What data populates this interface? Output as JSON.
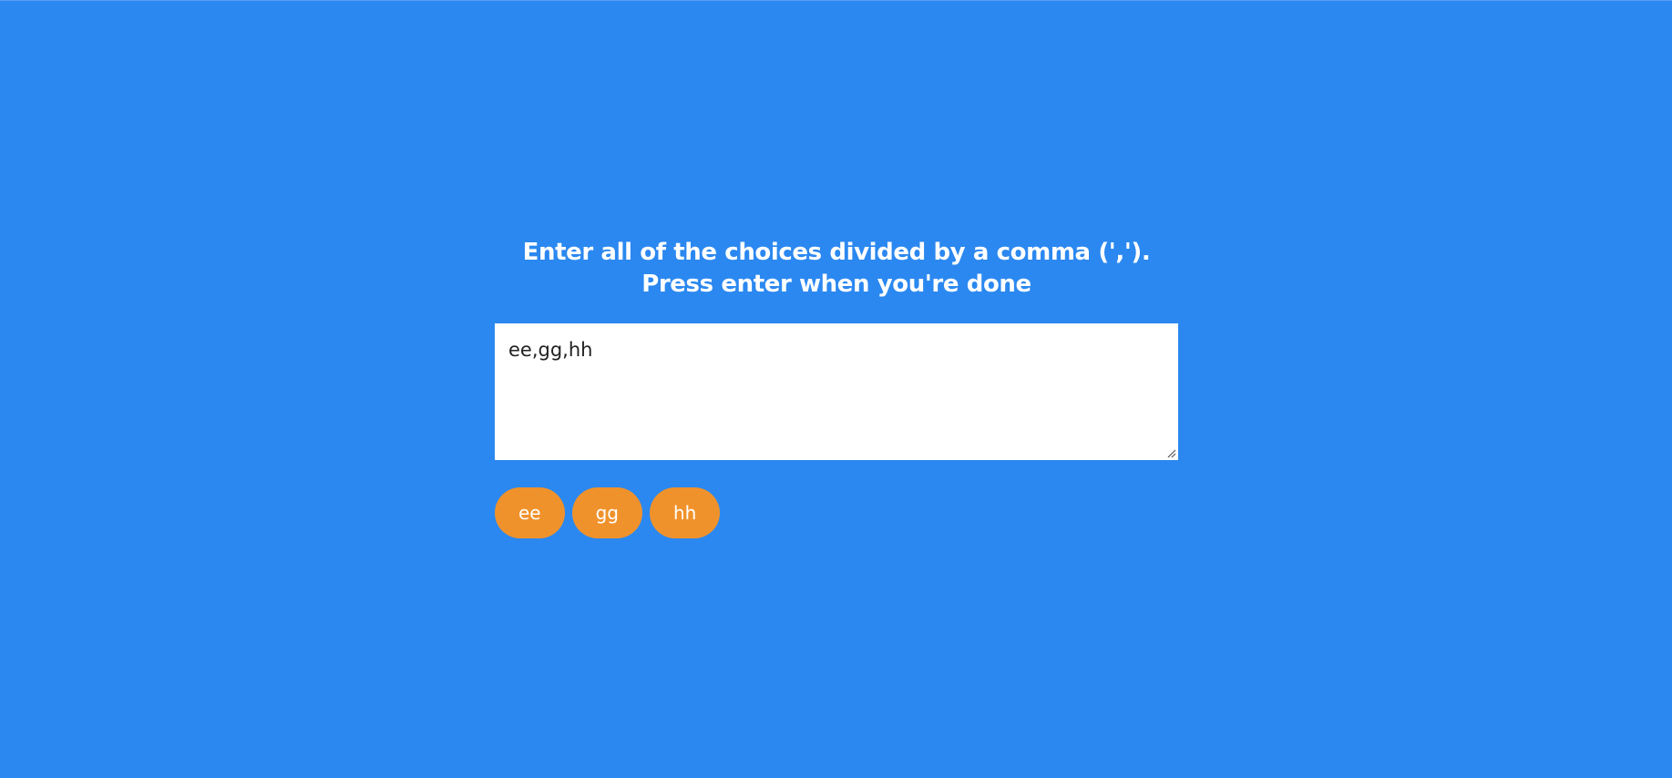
{
  "prompt": {
    "line1": "Enter all of the choices divided by a comma (',').",
    "line2": "Press enter when you're done"
  },
  "input": {
    "value": "ee,gg,hh",
    "placeholder": ""
  },
  "choices": [
    "ee",
    "gg",
    "hh"
  ],
  "colors": {
    "background": "#2b88f0",
    "tag": "#f0922b",
    "text": "#ffffff"
  }
}
